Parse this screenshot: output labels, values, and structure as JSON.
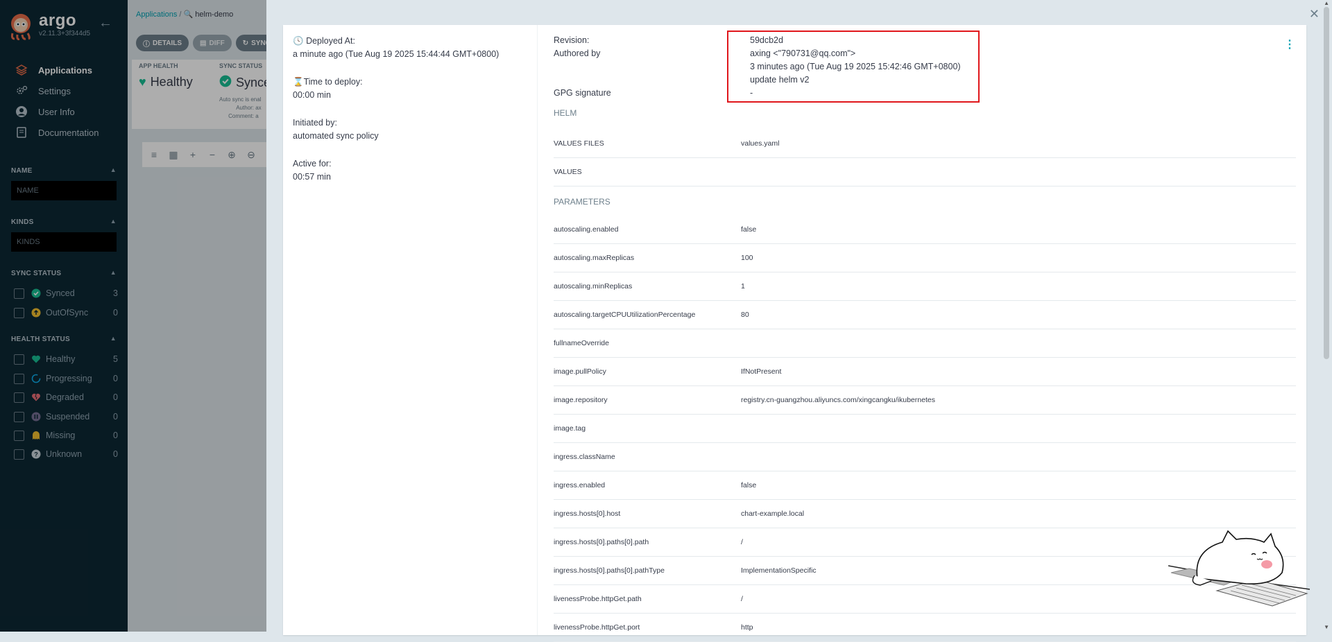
{
  "sidebar": {
    "logo_name": "argo",
    "version": "v2.11.3+3f344d5",
    "nav": [
      {
        "label": "Applications",
        "icon": "layers-icon"
      },
      {
        "label": "Settings",
        "icon": "gears-icon"
      },
      {
        "label": "User Info",
        "icon": "user-icon"
      },
      {
        "label": "Documentation",
        "icon": "book-icon"
      }
    ],
    "filters": {
      "name_title": "NAME",
      "name_placeholder": "NAME",
      "kinds_title": "KINDS",
      "kinds_placeholder": "KINDS",
      "sync_title": "SYNC STATUS",
      "sync_items": [
        {
          "label": "Synced",
          "count": "3",
          "icon": "check-circle-icon",
          "color": "#18be94"
        },
        {
          "label": "OutOfSync",
          "count": "0",
          "icon": "arrow-up-circle-icon",
          "color": "#f4c030"
        }
      ],
      "health_title": "HEALTH STATUS",
      "health_items": [
        {
          "label": "Healthy",
          "count": "5",
          "icon": "heart-icon",
          "color": "#18be94"
        },
        {
          "label": "Progressing",
          "count": "0",
          "icon": "circle-notch-icon",
          "color": "#0dadea"
        },
        {
          "label": "Degraded",
          "count": "0",
          "icon": "broken-heart-icon",
          "color": "#e96d76"
        },
        {
          "label": "Suspended",
          "count": "0",
          "icon": "pause-circle-icon",
          "color": "#766f94"
        },
        {
          "label": "Missing",
          "count": "0",
          "icon": "ghost-icon",
          "color": "#f4c030"
        },
        {
          "label": "Unknown",
          "count": "0",
          "icon": "question-circle-icon",
          "color": "#ccd6dd"
        }
      ]
    }
  },
  "background": {
    "breadcrumb_root": "Applications",
    "breadcrumb_sep": "/",
    "breadcrumb_app": "helm-demo",
    "btn_details": "DETAILS",
    "btn_diff": "DIFF",
    "btn_sync": "SYNC",
    "app_health_title": "APP HEALTH",
    "app_health_value": "Healthy",
    "sync_status_title": "SYNC STATUS",
    "sync_status_value": "Synce",
    "auto_sync_text": "Auto sync is enal",
    "author_label": "Author:",
    "author_value": "ax",
    "comment_label": "Comment:",
    "comment_value": "a"
  },
  "details": {
    "deployed_at_label": "Deployed At:",
    "deployed_at_value": "a minute ago (Tue Aug 19 2025 15:44:44 GMT+0800)",
    "time_to_deploy_label": "Time to deploy:",
    "time_to_deploy_value": "00:00 min",
    "initiated_by_label": "Initiated by:",
    "initiated_by_value": "automated sync policy",
    "active_for_label": "Active for:",
    "active_for_value": "00:57 min",
    "revision_label": "Revision:",
    "revision_value": "59dcb2d",
    "authored_by_label": "Authored by",
    "author_value": "axing <\"790731@qq.com\">",
    "commit_time": "3 minutes ago (Tue Aug 19 2025 15:42:46 GMT+0800)",
    "commit_message": "update helm v2",
    "gpg_label": "GPG signature",
    "gpg_value": "-",
    "helm_title": "HELM",
    "values_files_label": "VALUES FILES",
    "values_files_value": "values.yaml",
    "values_label": "VALUES",
    "values_value": "",
    "parameters_title": "PARAMETERS",
    "parameters": [
      {
        "key": "autoscaling.enabled",
        "value": "false"
      },
      {
        "key": "autoscaling.maxReplicas",
        "value": "100"
      },
      {
        "key": "autoscaling.minReplicas",
        "value": "1"
      },
      {
        "key": "autoscaling.targetCPUUtilizationPercentage",
        "value": "80"
      },
      {
        "key": "fullnameOverride",
        "value": ""
      },
      {
        "key": "image.pullPolicy",
        "value": "IfNotPresent"
      },
      {
        "key": "image.repository",
        "value": "registry.cn-guangzhou.aliyuncs.com/xingcangku/ikubernetes"
      },
      {
        "key": "image.tag",
        "value": ""
      },
      {
        "key": "ingress.className",
        "value": ""
      },
      {
        "key": "ingress.enabled",
        "value": "false"
      },
      {
        "key": "ingress.hosts[0].host",
        "value": "chart-example.local"
      },
      {
        "key": "ingress.hosts[0].paths[0].path",
        "value": "/"
      },
      {
        "key": "ingress.hosts[0].paths[0].pathType",
        "value": "ImplementationSpecific"
      },
      {
        "key": "livenessProbe.httpGet.path",
        "value": "/"
      },
      {
        "key": "livenessProbe.httpGet.port",
        "value": "http"
      }
    ]
  },
  "colors": {
    "sidebar_bg": "#0d2834",
    "accent": "#00a2b3",
    "healthy": "#18be94",
    "highlight_box": "#e0161b"
  }
}
